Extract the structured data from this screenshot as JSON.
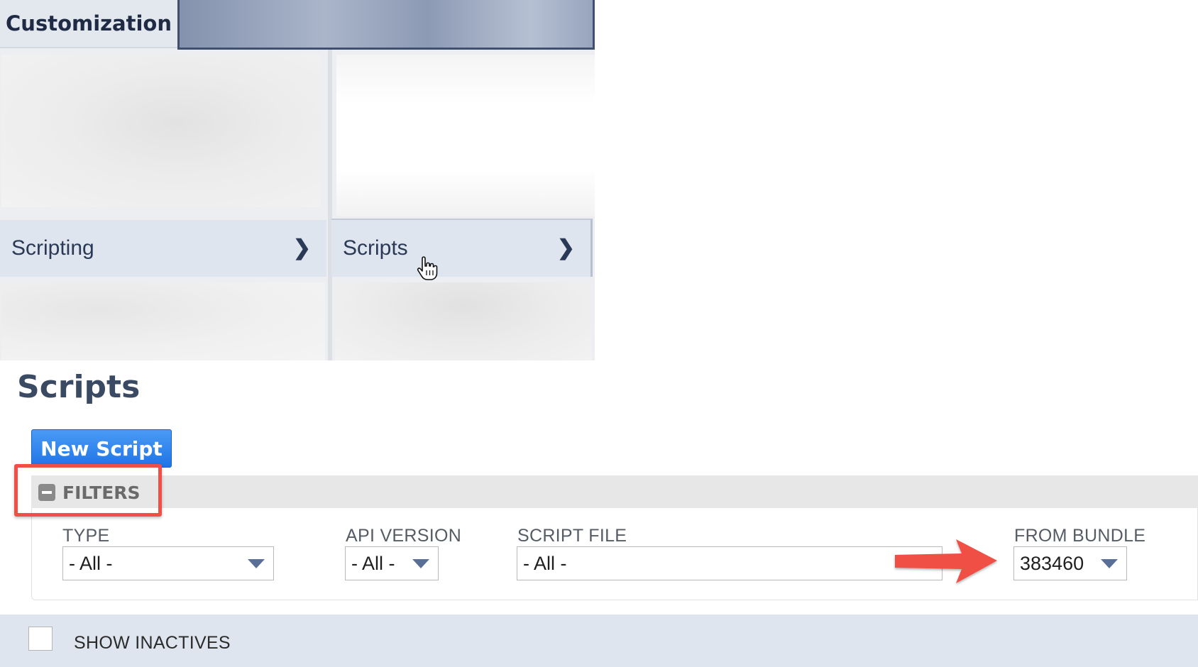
{
  "menu": {
    "active_tab": "Customization",
    "items": [
      {
        "label": "Scripting"
      },
      {
        "label": "Scripts"
      }
    ]
  },
  "page": {
    "title": "Scripts",
    "new_button": "New Script"
  },
  "filters": {
    "header": "FILTERS",
    "fields": {
      "type": {
        "label": "TYPE",
        "value": "- All -"
      },
      "api_version": {
        "label": "API VERSION",
        "value": "- All -"
      },
      "script_file": {
        "label": "SCRIPT FILE",
        "value": "- All -"
      },
      "from_bundle": {
        "label": "FROM BUNDLE",
        "value": "383460"
      }
    }
  },
  "show_inactives": {
    "label": "SHOW INACTIVES",
    "checked": false
  },
  "annotations": {
    "highlight_color": "#ef4f44",
    "arrow_color": "#ef4f44"
  }
}
